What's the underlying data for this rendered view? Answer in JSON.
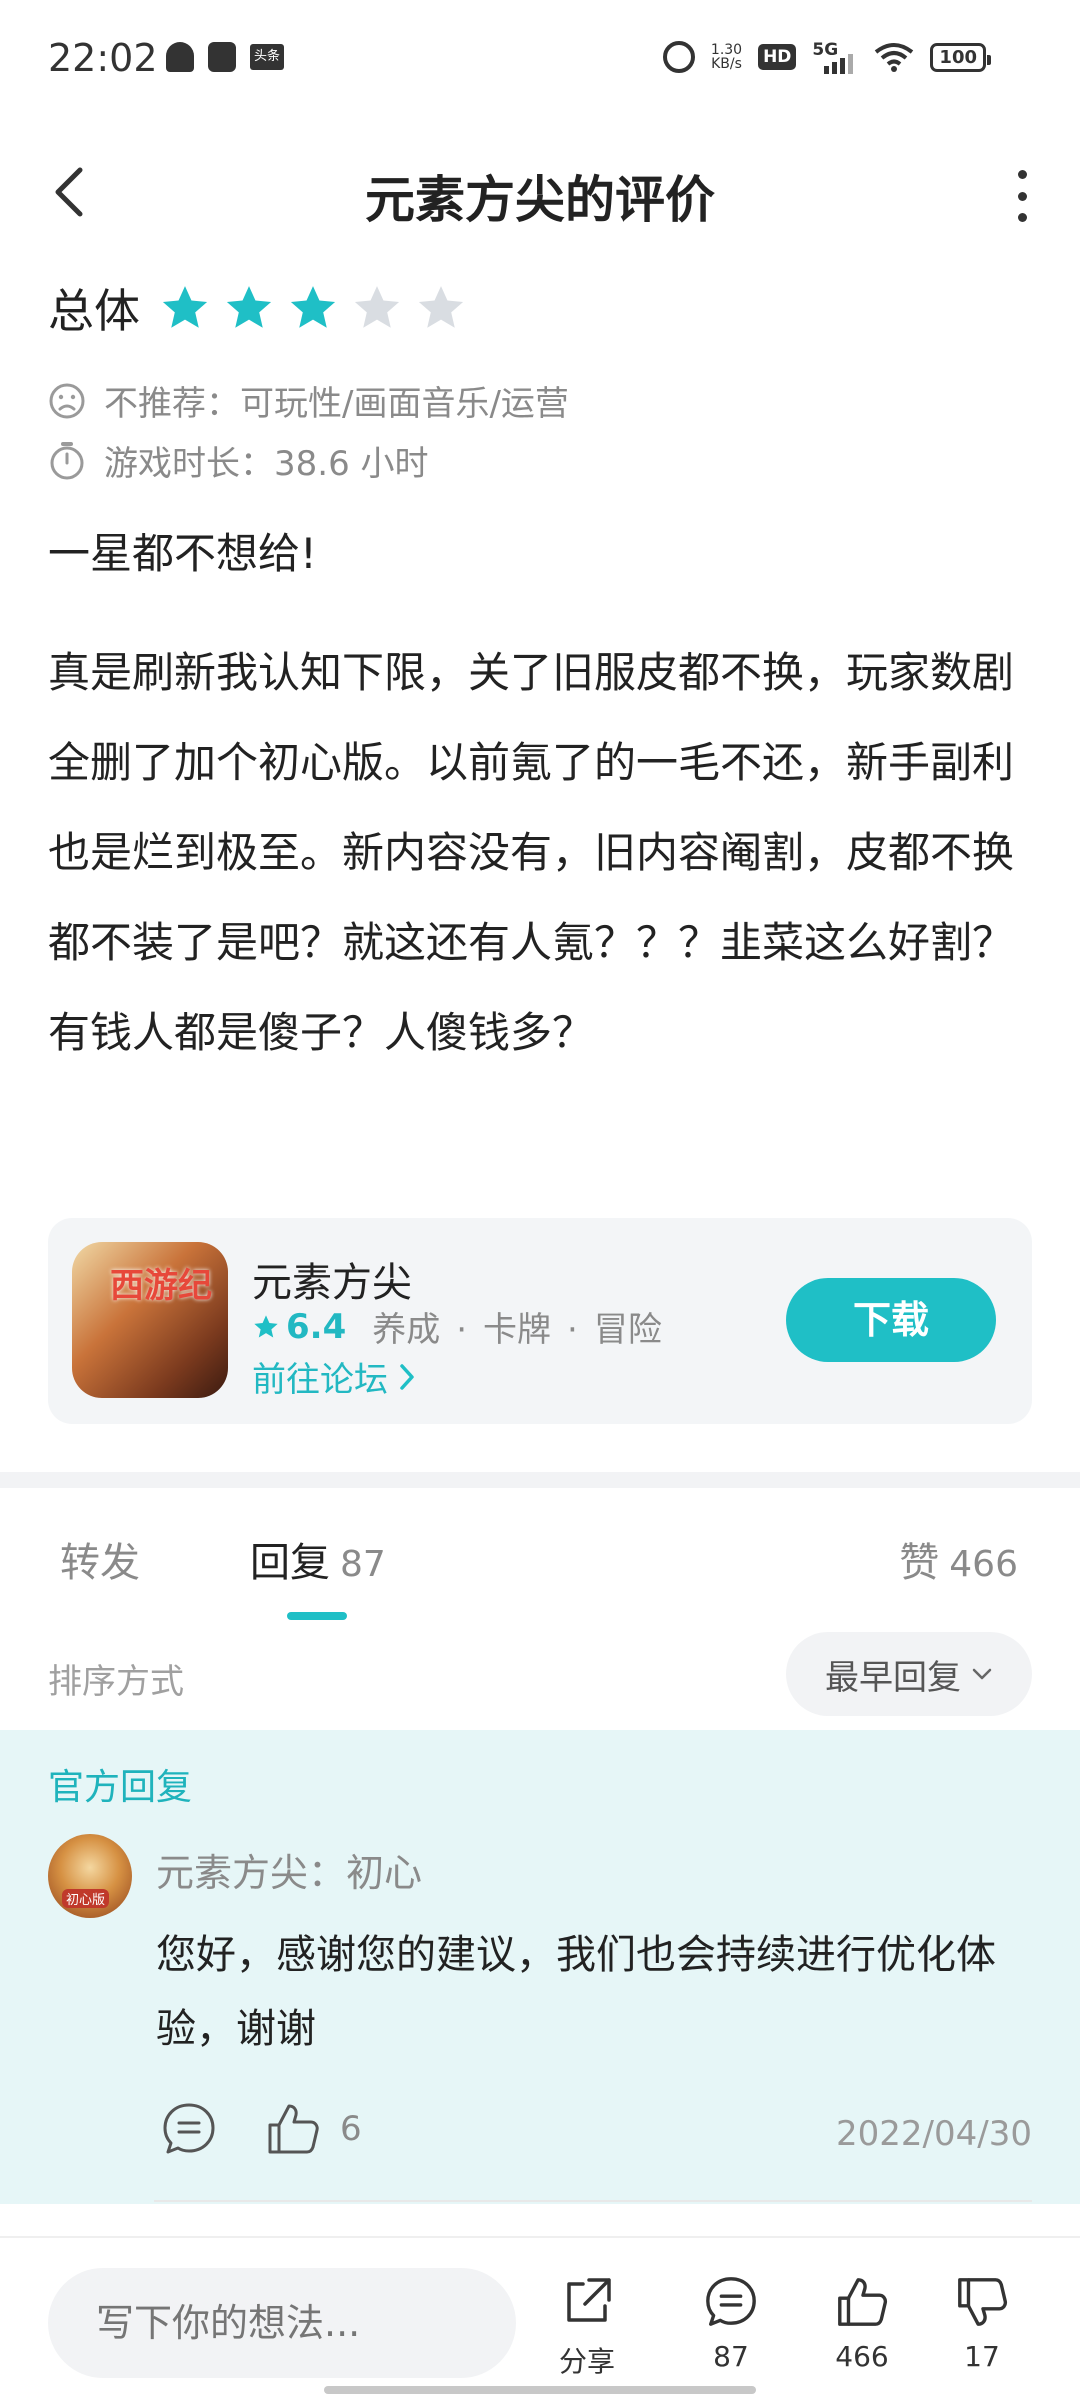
{
  "status_bar": {
    "time": "22:02",
    "news_badge": "头条",
    "net_speed_value": "1.30",
    "net_speed_unit": "KB/s",
    "hd": "HD",
    "network": "5G",
    "battery": "100"
  },
  "nav": {
    "title": "元素方尖的评价"
  },
  "rating": {
    "label": "总体",
    "stars_filled": 3,
    "stars_total": 5,
    "accent_color": "#1fbfc6"
  },
  "meta": {
    "not_recommend": "不推荐：可玩性/画面音乐/运营",
    "play_time": "游戏时长：38.6 小时"
  },
  "review": {
    "title": "一星都不想给!",
    "body": "真是刷新我认知下限，关了旧服皮都不换，玩家数剧全删了加个初心版。以前氪了的一毛不还，新手副利也是烂到极至。新内容没有，旧内容阉割，皮都不换都不装了是吧？就这还有人氪？？？韭菜这么好割？有钱人都是傻子？人傻钱多？"
  },
  "game_card": {
    "icon_text": "西游纪",
    "name": "元素方尖",
    "score": "6.4",
    "tags": [
      "养成",
      "卡牌",
      "冒险"
    ],
    "forum_link": "前往论坛",
    "download_label": "下载"
  },
  "tabs": {
    "forward": "转发",
    "reply": "回复",
    "reply_count": "87",
    "like": "赞",
    "like_count": "466"
  },
  "sort": {
    "label": "排序方式",
    "selected": "最早回复"
  },
  "official_reply": {
    "label": "官方回复",
    "avatar_tag": "初心版",
    "author": "元素方尖：初心",
    "text": "您好，感谢您的建议，我们也会持续进行优化体验，谢谢",
    "like_count": "6",
    "date": "2022/04/30"
  },
  "bottom_bar": {
    "input_placeholder": "写下你的想法...",
    "share_label": "分享",
    "comment_count": "87",
    "like_count": "466",
    "dislike_count": "17"
  }
}
